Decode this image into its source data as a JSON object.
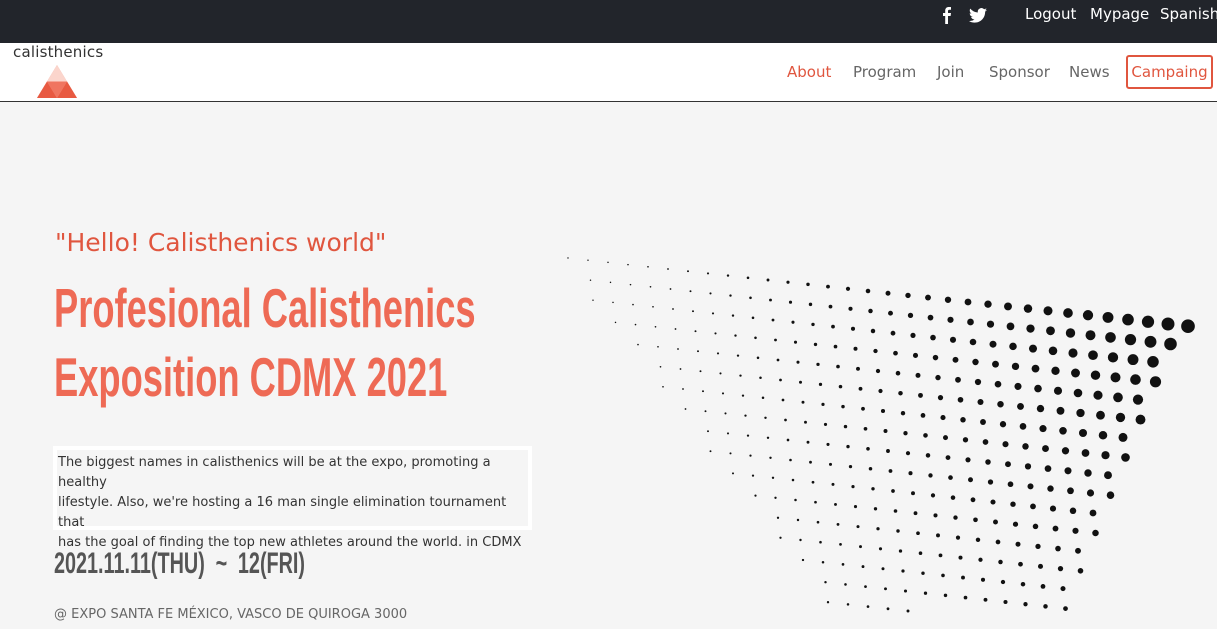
{
  "topbar": {
    "social": [
      "facebook-icon",
      "twitter-icon"
    ],
    "links": [
      "Logout",
      "Mypage",
      "Spanish"
    ]
  },
  "logo": {
    "text": "calisthenics"
  },
  "nav": {
    "items": [
      "About",
      "Program",
      "Join",
      "Sponsor",
      "News"
    ],
    "active": "About",
    "campaign_label": "Campaing"
  },
  "hero": {
    "greeting": "\"Hello! Calisthenics world\"",
    "headline_line1": "Profesional Calisthenics",
    "headline_line2": "Exposition CDMX 2021",
    "intro": "The biggest names in calisthenics will be at the expo, promoting a healthy lifestyle. Also, we're hosting a 16 man single elimination tournament that has the goal of finding the top new athletes around the world. in CDMX",
    "intro_lines": [
      "The biggest names in calisthenics will be at the expo, promoting a healthy",
      "lifestyle. Also, we're hosting a 16 man single elimination tournament that",
      "has the goal of finding the top new athletes around the world. in CDMX"
    ],
    "dates": "2021.11.11(THU)  ~  12(FRI)",
    "venue": "@ EXPO SANTA FE MÉXICO, VASCO DE QUIROGA 3000"
  },
  "colors": {
    "accent": "#e0563f",
    "headline": "#ee6a55",
    "topbar_bg": "#22252b",
    "page_bg": "#f5f5f5"
  }
}
